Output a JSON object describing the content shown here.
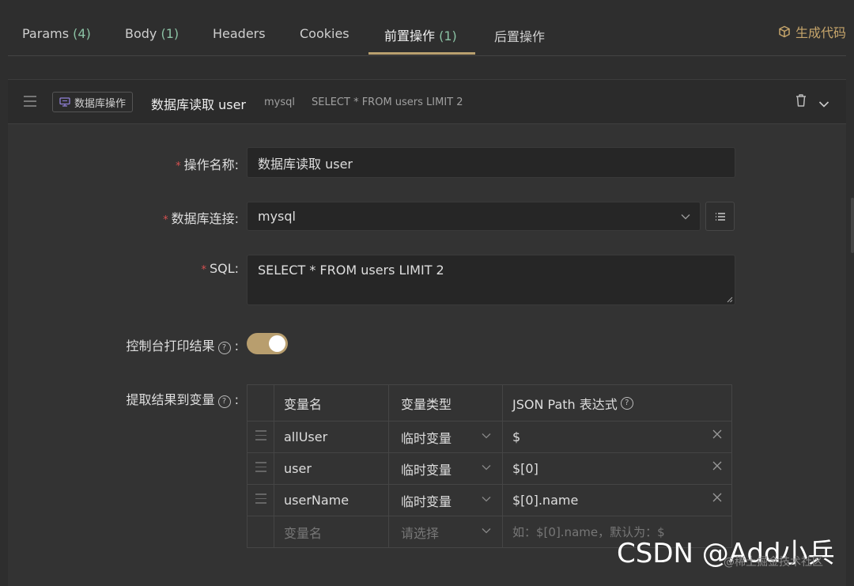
{
  "tabs": [
    {
      "label": "Params",
      "count": "(4)"
    },
    {
      "label": "Body",
      "count": "(1)"
    },
    {
      "label": "Headers",
      "count": ""
    },
    {
      "label": "Cookies",
      "count": ""
    },
    {
      "label": "前置操作",
      "count": "(1)"
    },
    {
      "label": "后置操作",
      "count": ""
    }
  ],
  "generate_code_label": "生成代码",
  "operation": {
    "type_tag": "数据库操作",
    "title": "数据库读取 user",
    "db": "mysql",
    "sql_preview": "SELECT * FROM users LIMIT 2"
  },
  "form": {
    "name_label": "操作名称",
    "name_value": "数据库读取 user",
    "db_label": "数据库连接",
    "db_value": "mysql",
    "sql_label": "SQL",
    "sql_value": "SELECT * FROM users LIMIT 2",
    "console_label": "控制台打印结果",
    "console_enabled": true,
    "extract_label": "提取结果到变量"
  },
  "colon": ":",
  "qmark": "?",
  "table": {
    "headers": [
      "变量名",
      "变量类型",
      "JSON Path 表达式"
    ],
    "rows": [
      {
        "name": "allUser",
        "type": "临时变量",
        "path": "$"
      },
      {
        "name": "user",
        "type": "临时变量",
        "path": "$[0]"
      },
      {
        "name": "userName",
        "type": "临时变量",
        "path": "$[0].name"
      }
    ],
    "new_row": {
      "name_placeholder": "变量名",
      "type_placeholder": "请选择",
      "path_placeholder": "如：$[0].name，默认为：$"
    }
  },
  "watermark": "CSDN @Add小兵",
  "watermark_small": "@稀土掘金技术社区",
  "colors": {
    "accent": "#b89e6e",
    "count_green": "#8bc2a4",
    "required": "#d65050"
  }
}
